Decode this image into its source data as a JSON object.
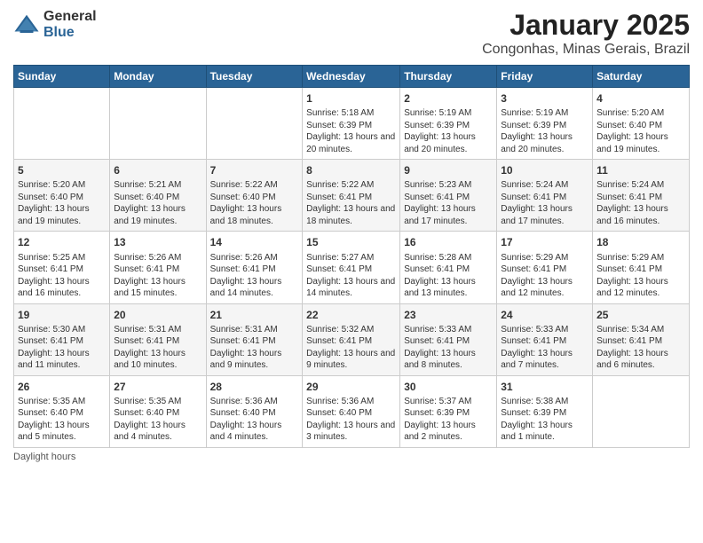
{
  "logo": {
    "general": "General",
    "blue": "Blue"
  },
  "title": "January 2025",
  "subtitle": "Congonhas, Minas Gerais, Brazil",
  "days_of_week": [
    "Sunday",
    "Monday",
    "Tuesday",
    "Wednesday",
    "Thursday",
    "Friday",
    "Saturday"
  ],
  "weeks": [
    [
      {
        "day": "",
        "sunrise": "",
        "sunset": "",
        "daylight": ""
      },
      {
        "day": "",
        "sunrise": "",
        "sunset": "",
        "daylight": ""
      },
      {
        "day": "",
        "sunrise": "",
        "sunset": "",
        "daylight": ""
      },
      {
        "day": "1",
        "sunrise": "5:18 AM",
        "sunset": "6:39 PM",
        "daylight": "13 hours and 20 minutes."
      },
      {
        "day": "2",
        "sunrise": "5:19 AM",
        "sunset": "6:39 PM",
        "daylight": "13 hours and 20 minutes."
      },
      {
        "day": "3",
        "sunrise": "5:19 AM",
        "sunset": "6:39 PM",
        "daylight": "13 hours and 20 minutes."
      },
      {
        "day": "4",
        "sunrise": "5:20 AM",
        "sunset": "6:40 PM",
        "daylight": "13 hours and 19 minutes."
      }
    ],
    [
      {
        "day": "5",
        "sunrise": "5:20 AM",
        "sunset": "6:40 PM",
        "daylight": "13 hours and 19 minutes."
      },
      {
        "day": "6",
        "sunrise": "5:21 AM",
        "sunset": "6:40 PM",
        "daylight": "13 hours and 19 minutes."
      },
      {
        "day": "7",
        "sunrise": "5:22 AM",
        "sunset": "6:40 PM",
        "daylight": "13 hours and 18 minutes."
      },
      {
        "day": "8",
        "sunrise": "5:22 AM",
        "sunset": "6:41 PM",
        "daylight": "13 hours and 18 minutes."
      },
      {
        "day": "9",
        "sunrise": "5:23 AM",
        "sunset": "6:41 PM",
        "daylight": "13 hours and 17 minutes."
      },
      {
        "day": "10",
        "sunrise": "5:24 AM",
        "sunset": "6:41 PM",
        "daylight": "13 hours and 17 minutes."
      },
      {
        "day": "11",
        "sunrise": "5:24 AM",
        "sunset": "6:41 PM",
        "daylight": "13 hours and 16 minutes."
      }
    ],
    [
      {
        "day": "12",
        "sunrise": "5:25 AM",
        "sunset": "6:41 PM",
        "daylight": "13 hours and 16 minutes."
      },
      {
        "day": "13",
        "sunrise": "5:26 AM",
        "sunset": "6:41 PM",
        "daylight": "13 hours and 15 minutes."
      },
      {
        "day": "14",
        "sunrise": "5:26 AM",
        "sunset": "6:41 PM",
        "daylight": "13 hours and 14 minutes."
      },
      {
        "day": "15",
        "sunrise": "5:27 AM",
        "sunset": "6:41 PM",
        "daylight": "13 hours and 14 minutes."
      },
      {
        "day": "16",
        "sunrise": "5:28 AM",
        "sunset": "6:41 PM",
        "daylight": "13 hours and 13 minutes."
      },
      {
        "day": "17",
        "sunrise": "5:29 AM",
        "sunset": "6:41 PM",
        "daylight": "13 hours and 12 minutes."
      },
      {
        "day": "18",
        "sunrise": "5:29 AM",
        "sunset": "6:41 PM",
        "daylight": "13 hours and 12 minutes."
      }
    ],
    [
      {
        "day": "19",
        "sunrise": "5:30 AM",
        "sunset": "6:41 PM",
        "daylight": "13 hours and 11 minutes."
      },
      {
        "day": "20",
        "sunrise": "5:31 AM",
        "sunset": "6:41 PM",
        "daylight": "13 hours and 10 minutes."
      },
      {
        "day": "21",
        "sunrise": "5:31 AM",
        "sunset": "6:41 PM",
        "daylight": "13 hours and 9 minutes."
      },
      {
        "day": "22",
        "sunrise": "5:32 AM",
        "sunset": "6:41 PM",
        "daylight": "13 hours and 9 minutes."
      },
      {
        "day": "23",
        "sunrise": "5:33 AM",
        "sunset": "6:41 PM",
        "daylight": "13 hours and 8 minutes."
      },
      {
        "day": "24",
        "sunrise": "5:33 AM",
        "sunset": "6:41 PM",
        "daylight": "13 hours and 7 minutes."
      },
      {
        "day": "25",
        "sunrise": "5:34 AM",
        "sunset": "6:41 PM",
        "daylight": "13 hours and 6 minutes."
      }
    ],
    [
      {
        "day": "26",
        "sunrise": "5:35 AM",
        "sunset": "6:40 PM",
        "daylight": "13 hours and 5 minutes."
      },
      {
        "day": "27",
        "sunrise": "5:35 AM",
        "sunset": "6:40 PM",
        "daylight": "13 hours and 4 minutes."
      },
      {
        "day": "28",
        "sunrise": "5:36 AM",
        "sunset": "6:40 PM",
        "daylight": "13 hours and 4 minutes."
      },
      {
        "day": "29",
        "sunrise": "5:36 AM",
        "sunset": "6:40 PM",
        "daylight": "13 hours and 3 minutes."
      },
      {
        "day": "30",
        "sunrise": "5:37 AM",
        "sunset": "6:39 PM",
        "daylight": "13 hours and 2 minutes."
      },
      {
        "day": "31",
        "sunrise": "5:38 AM",
        "sunset": "6:39 PM",
        "daylight": "13 hours and 1 minute."
      },
      {
        "day": "",
        "sunrise": "",
        "sunset": "",
        "daylight": ""
      }
    ]
  ],
  "footer": {
    "daylight_hours": "Daylight hours"
  }
}
